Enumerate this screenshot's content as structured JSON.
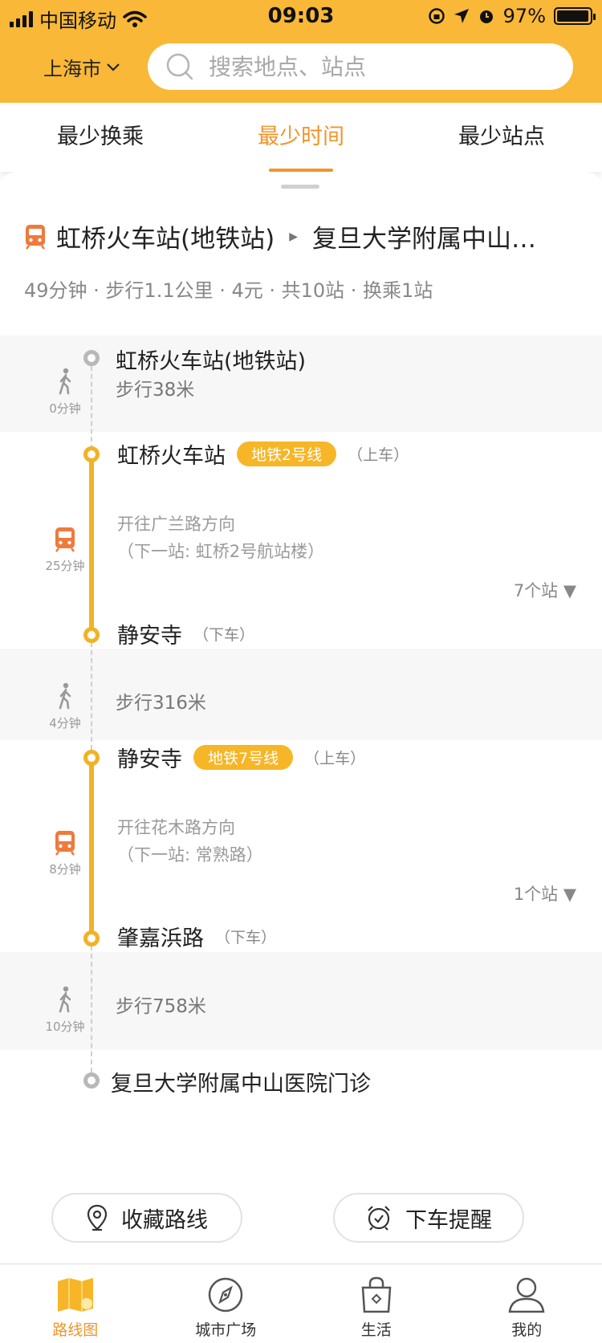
{
  "status_bar": {
    "carrier": "中国移动",
    "time": "09:03",
    "battery": "97%",
    "battery_level": 0.97
  },
  "header": {
    "city": "上海市",
    "search_placeholder": "搜索地点、站点"
  },
  "tabs": [
    {
      "label": "最少换乘",
      "active": false
    },
    {
      "label": "最少时间",
      "active": true
    },
    {
      "label": "最少站点",
      "active": false
    }
  ],
  "route": {
    "origin": "虹桥火车站(地铁站)",
    "destination": "复旦大学附属中山…",
    "summary": "49分钟 · 步行1.1公里 · 4元 · 共10站 · 换乘1站"
  },
  "segments": {
    "start_name": "虹桥火车站(地铁站)",
    "walk1": {
      "distance": "步行38米",
      "minutes": "0分钟"
    },
    "ride1": {
      "board_station": "虹桥火车站",
      "line": "地铁2号线",
      "board_note": "（上车）",
      "direction": "开往广兰路方向",
      "next_stop": "（下一站: 虹桥2号航站楼）",
      "stops": "7个站 ▼",
      "minutes": "25分钟",
      "alight_station": "静安寺",
      "alight_note": "（下车）"
    },
    "walk2": {
      "distance": "步行316米",
      "minutes": "4分钟"
    },
    "ride2": {
      "board_station": "静安寺",
      "line": "地铁7号线",
      "board_note": "（上车）",
      "direction": "开往花木路方向",
      "next_stop": "（下一站: 常熟路）",
      "stops": "1个站 ▼",
      "minutes": "8分钟",
      "alight_station": "肇嘉浜路",
      "alight_note": "（下车）"
    },
    "walk3": {
      "distance": "步行758米",
      "minutes": "10分钟"
    },
    "end_name": "复旦大学附属中山医院门诊"
  },
  "actions": {
    "favorite": "收藏路线",
    "alarm": "下车提醒"
  },
  "tabbar": [
    {
      "label": "路线图",
      "icon": "map-icon",
      "active": true
    },
    {
      "label": "城市广场",
      "icon": "compass-icon",
      "active": false
    },
    {
      "label": "生活",
      "icon": "shopping-bag-icon",
      "active": false
    },
    {
      "label": "我的",
      "icon": "user-icon",
      "active": false
    }
  ],
  "colors": {
    "brand": "#f9b837",
    "accent": "#f0952a",
    "line": "#f1b226"
  }
}
